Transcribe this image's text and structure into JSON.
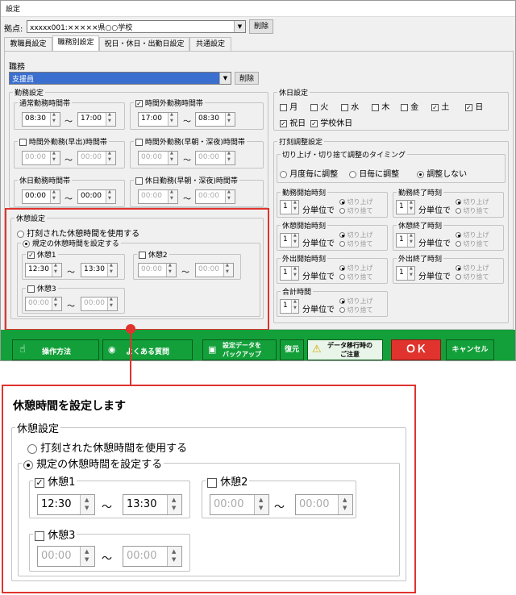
{
  "window": {
    "title": "設定"
  },
  "location": {
    "label": "拠点:",
    "value": "xxxxx001:×××××県○○学校",
    "delete_label": "削除"
  },
  "tabs": [
    {
      "label": "教職員設定"
    },
    {
      "label": "職務別設定"
    },
    {
      "label": "祝日・休日・出勤日設定"
    },
    {
      "label": "共通設定"
    }
  ],
  "duty": {
    "label": "職務",
    "value": "支援員",
    "delete_label": "削除"
  },
  "work_settings": {
    "label": "勤務設定",
    "normal": {
      "label": "通常勤務時間帯",
      "start": "08:30",
      "end": "17:00"
    },
    "overtime": {
      "label": "時間外勤務時間帯",
      "start": "17:00",
      "end": "08:30"
    },
    "early": {
      "label": "時間外勤務(早出)時間帯",
      "start": "00:00",
      "end": "00:00"
    },
    "early_deep": {
      "label": "時間外勤務(早朝・深夜)時間帯",
      "start": "00:00",
      "end": "00:00"
    },
    "holiday": {
      "label": "休日勤務時間帯",
      "start": "00:00",
      "end": "00:00"
    },
    "holiday_early": {
      "label": "休日勤務(早朝・深夜)時間帯",
      "start": "00:00",
      "end": "00:00"
    }
  },
  "break_settings": {
    "label": "休憩設定",
    "use_stamped": "打刻された休憩時間を使用する",
    "use_fixed": "規定の休憩時間を設定する",
    "break1": {
      "label": "休憩1",
      "start": "12:30",
      "end": "13:30"
    },
    "break2": {
      "label": "休憩2",
      "start": "00:00",
      "end": "00:00"
    },
    "break3": {
      "label": "休憩3",
      "start": "00:00",
      "end": "00:00"
    }
  },
  "tilde": "〜",
  "holiday_settings": {
    "label": "休日設定",
    "days": [
      "月",
      "火",
      "水",
      "木",
      "金",
      "土",
      "日"
    ],
    "checked": [
      false,
      false,
      false,
      false,
      false,
      true,
      true
    ],
    "holiday": "祝日",
    "school_holiday": "学校休日"
  },
  "stamp_settings": {
    "label": "打刻調整設定",
    "timing": {
      "label": "切り上げ・切り捨て調整のタイミング",
      "options": [
        "月度毎に調整",
        "日毎に調整",
        "調整しない"
      ]
    },
    "groups": [
      {
        "label": "勤務開始時刻"
      },
      {
        "label": "勤務終了時刻"
      },
      {
        "label": "休憩開始時刻"
      },
      {
        "label": "休憩終了時刻"
      },
      {
        "label": "外出開始時刻"
      },
      {
        "label": "外出終了時刻"
      },
      {
        "label": "合計時間"
      }
    ],
    "unit_value": "1",
    "unit_label": "分単位で",
    "round_up": "切り上げ",
    "round_down": "切り捨て"
  },
  "buttons": {
    "howto": "操作方法",
    "faq": "よくある質問",
    "backup": "設定データを\nバックアップ",
    "restore": "復元",
    "migration": "データ移行時の\nご注意",
    "ok": "ＯＫ",
    "cancel": "キャンセル"
  },
  "callout": {
    "title": "休憩時間を設定します"
  },
  "colors": {
    "accent_green": "#13a03a",
    "ok_red": "#e0332e",
    "callout_red": "#e0332e",
    "select_blue": "#3a6fd0"
  }
}
